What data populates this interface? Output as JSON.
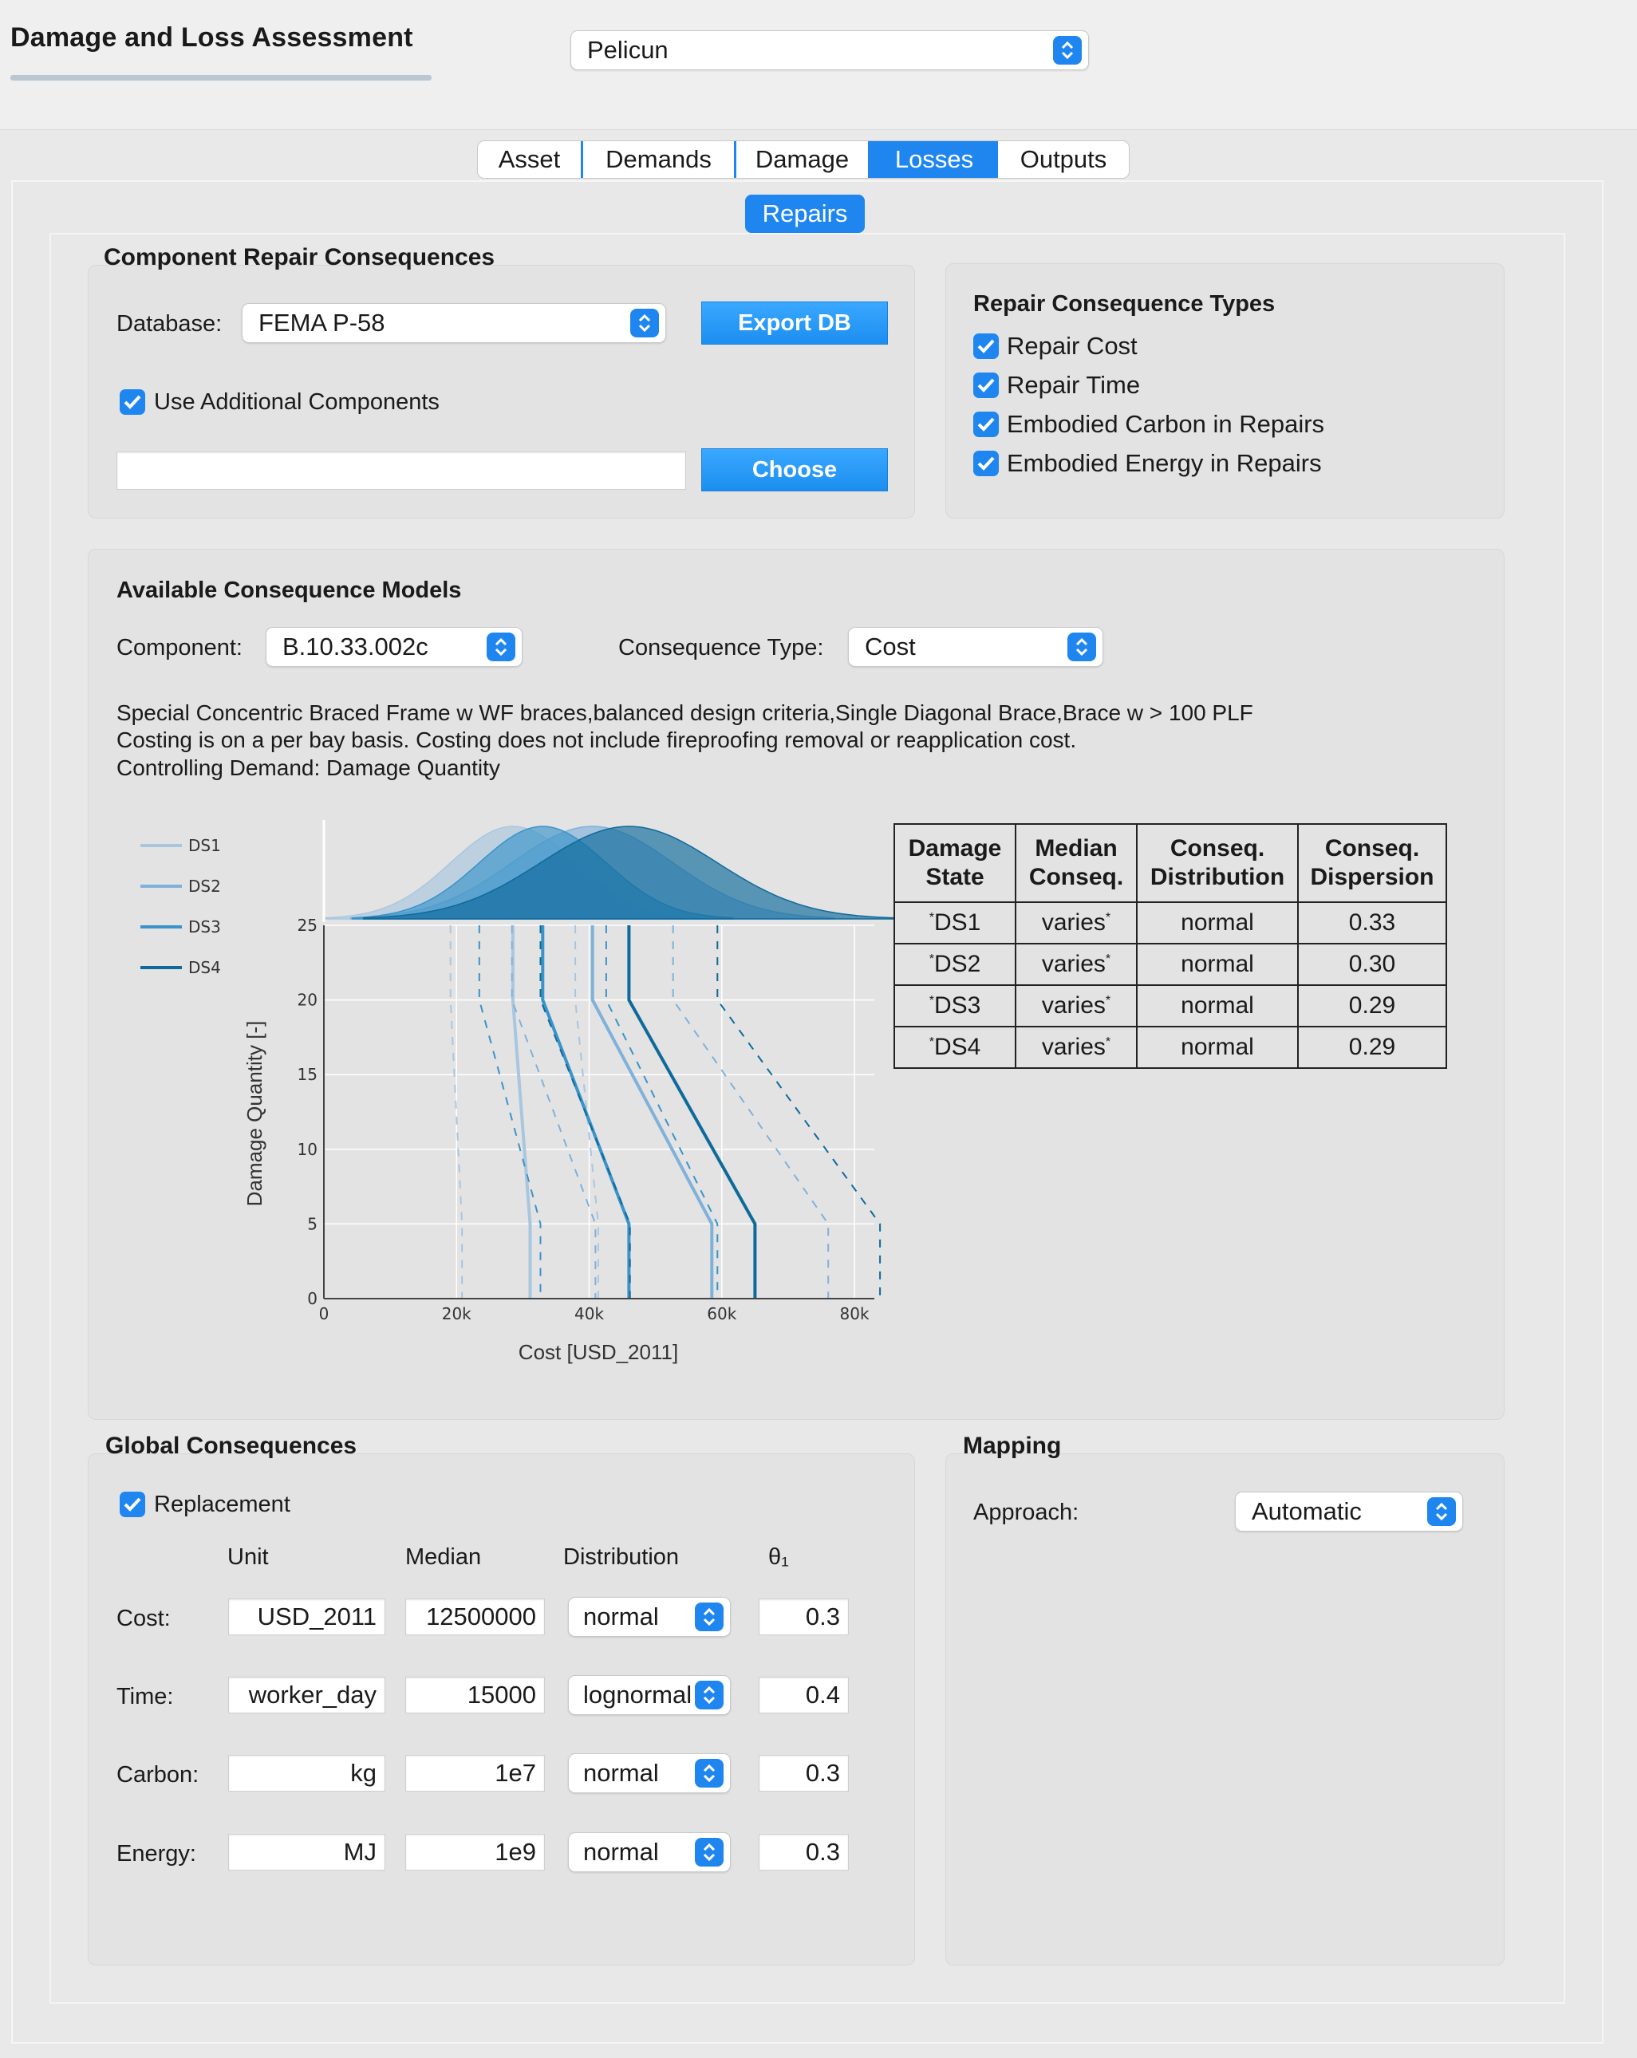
{
  "header": {
    "title": "Damage and Loss Assessment",
    "app_select": "Pelicun"
  },
  "tabs": [
    "Asset",
    "Demands",
    "Damage",
    "Losses",
    "Outputs"
  ],
  "subtab": "Repairs",
  "component_repair": {
    "title": "Component Repair Consequences",
    "database_label": "Database:",
    "database_value": "FEMA P-58",
    "export_button": "Export DB",
    "use_additional_label": "Use Additional Components",
    "additional_path": "",
    "choose_button": "Choose"
  },
  "consequence_types": {
    "title": "Repair Consequence Types",
    "items": [
      "Repair Cost",
      "Repair Time",
      "Embodied Carbon in Repairs",
      "Embodied Energy in Repairs"
    ]
  },
  "models": {
    "title": "Available Consequence Models",
    "component_label": "Component:",
    "component_value": "B.10.33.002c",
    "type_label": "Consequence Type:",
    "type_value": "Cost",
    "description": [
      "Special Concentric Braced Frame w WF braces,balanced design criteria,Single Diagonal Brace,Brace w > 100 PLF",
      "Costing is on a per bay basis. Costing does not include fireproofing removal or reapplication cost.",
      "Controlling Demand: Damage Quantity"
    ],
    "table": {
      "headers": [
        [
          "Damage",
          "State"
        ],
        [
          "Median",
          "Conseq."
        ],
        [
          "Conseq.",
          "Distribution"
        ],
        [
          "Conseq.",
          "Dispersion"
        ]
      ],
      "rows": [
        [
          "DS1",
          "varies",
          "normal",
          "0.33"
        ],
        [
          "DS2",
          "varies",
          "normal",
          "0.30"
        ],
        [
          "DS3",
          "varies",
          "normal",
          "0.29"
        ],
        [
          "DS4",
          "varies",
          "normal",
          "0.29"
        ]
      ]
    }
  },
  "chart_data": {
    "type": "line",
    "xlabel": "Cost [USD_2011]",
    "ylabel": "Damage Quantity [-]",
    "xlim": [
      0,
      83000
    ],
    "ylim": [
      0,
      25
    ],
    "xticks": [
      "0",
      "20k",
      "40k",
      "60k",
      "80k"
    ],
    "xtick_values": [
      0,
      20000,
      40000,
      60000,
      80000
    ],
    "yticks": [
      "0",
      "5",
      "10",
      "15",
      "20",
      "25"
    ],
    "ytick_values": [
      0,
      5,
      10,
      15,
      20,
      25
    ],
    "legend_position": "left",
    "series": [
      {
        "name": "DS1",
        "color": "#a9c6df",
        "x": [
          28500,
          28500,
          31100,
          31100
        ],
        "y": [
          25,
          20,
          5,
          0
        ],
        "dispersion": 0.33
      },
      {
        "name": "DS2",
        "color": "#7fb1da",
        "x": [
          40500,
          40500,
          58500,
          58500
        ],
        "y": [
          25,
          20,
          5,
          0
        ],
        "dispersion": 0.3
      },
      {
        "name": "DS3",
        "color": "#3a93c9",
        "x": [
          33000,
          33000,
          46000,
          46000
        ],
        "y": [
          25,
          20,
          5,
          0
        ],
        "dispersion": 0.29
      },
      {
        "name": "DS4",
        "color": "#0e6a9b",
        "x": [
          46000,
          46000,
          65000,
          65000
        ],
        "y": [
          25,
          20,
          5,
          0
        ],
        "dispersion": 0.29
      }
    ]
  },
  "global": {
    "title": "Global Consequences",
    "replacement_label": "Replacement",
    "headers": {
      "unit": "Unit",
      "median": "Median",
      "distribution": "Distribution",
      "theta": "θ₁"
    },
    "rows": [
      {
        "label": "Cost:",
        "unit": "USD_2011",
        "median": "12500000",
        "dist": "normal",
        "theta": "0.3"
      },
      {
        "label": "Time:",
        "unit": "worker_day",
        "median": "15000",
        "dist": "lognormal",
        "theta": "0.4"
      },
      {
        "label": "Carbon:",
        "unit": "kg",
        "median": "1e7",
        "dist": "normal",
        "theta": "0.3"
      },
      {
        "label": "Energy:",
        "unit": "MJ",
        "median": "1e9",
        "dist": "normal",
        "theta": "0.3"
      }
    ]
  },
  "mapping": {
    "title": "Mapping",
    "approach_label": "Approach:",
    "approach_value": "Automatic"
  },
  "colors": {
    "accent": "#1f86f0"
  }
}
